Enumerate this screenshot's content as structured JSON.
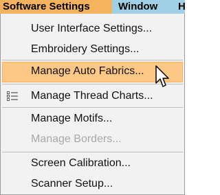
{
  "menubar": {
    "items": [
      {
        "label": "Software Settings"
      },
      {
        "label": "Window"
      },
      {
        "label": "H"
      }
    ]
  },
  "menu": {
    "items": [
      {
        "label": "User Interface Settings...",
        "state": "normal"
      },
      {
        "label": "Embroidery Settings...",
        "state": "normal"
      },
      {
        "label": "Manage Auto Fabrics...",
        "state": "highlighted"
      },
      {
        "label": "Manage Thread Charts...",
        "state": "normal",
        "icon": "list-icon"
      },
      {
        "label": "Manage Motifs...",
        "state": "normal"
      },
      {
        "label": "Manage Borders...",
        "state": "disabled"
      },
      {
        "label": "Screen Calibration...",
        "state": "normal"
      },
      {
        "label": "Scanner Setup...",
        "state": "normal"
      }
    ]
  },
  "colors": {
    "menubar_active": "#f5b35e",
    "menubar_inactive": "#9fd0e6",
    "highlight_bg": "#fdc785",
    "menu_bg": "#f2f2f2",
    "disabled_text": "#a8a8a8"
  }
}
